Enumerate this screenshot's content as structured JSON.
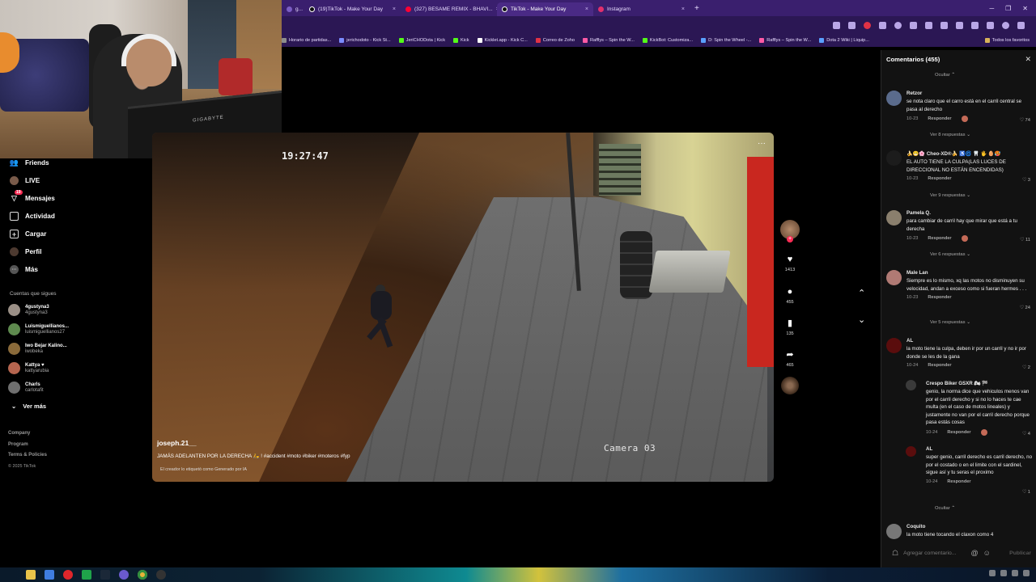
{
  "browser": {
    "tabs": [
      {
        "label": "g...",
        "icon_color": "#7b5dc4",
        "active": false
      },
      {
        "label": "(19)TikTok - Make Your Day",
        "icon_color": "#111111",
        "active": false
      },
      {
        "label": "(327) BESAME REMIX - BHAVI...",
        "icon_color": "#ff0033",
        "active": false
      },
      {
        "label": "TikTok - Make Your Day",
        "icon_color": "#111111",
        "active": true
      },
      {
        "label": "Instagram",
        "icon_color": "#e1306c",
        "active": false
      }
    ],
    "new_tab": "+",
    "bookmarks": [
      {
        "label": "Horario de partidas...",
        "color": "#8e8e8e"
      },
      {
        "label": "jerichodoto - Kick St...",
        "color": "#7b8cff"
      },
      {
        "label": "JeriCHODota | Kick",
        "color": "#53fc18"
      },
      {
        "label": "Kick",
        "color": "#53fc18"
      },
      {
        "label": "Kicklet.app - Kick C...",
        "color": "#ffffff"
      },
      {
        "label": "Correo de Zoho",
        "color": "#e03245"
      },
      {
        "label": "Rafflys – Spin the W...",
        "color": "#ff5aa5"
      },
      {
        "label": "KickBot: Customiza...",
        "color": "#53fc18"
      },
      {
        "label": "D: Spin the Wheel -...",
        "color": "#5aa0ff"
      },
      {
        "label": "Rafflys – Spin the W...",
        "color": "#ff5aa5"
      },
      {
        "label": "Dota 2 Wiki | Liquip...",
        "color": "#5aa0ff"
      }
    ],
    "all_bookmarks": "Todos los favoritos"
  },
  "webcam": {
    "monitor_brand": "GIGABYTE"
  },
  "nav": {
    "items": [
      {
        "label": "Friends",
        "icon": "friends-icon"
      },
      {
        "label": "LIVE",
        "icon": "live-icon"
      },
      {
        "label": "Mensajes",
        "icon": "messages-icon",
        "badge": "19"
      },
      {
        "label": "Actividad",
        "icon": "activity-icon"
      },
      {
        "label": "Cargar",
        "icon": "upload-icon"
      },
      {
        "label": "Perfil",
        "icon": "profile-icon"
      },
      {
        "label": "Más",
        "icon": "more-icon"
      }
    ],
    "following_heading": "Cuentas que sigues",
    "following": [
      {
        "name": "4gustyna3",
        "user": "4gustyna3",
        "color": "#9a8f86"
      },
      {
        "name": "Luismiguellianos...",
        "user": "luismiguellianos27",
        "color": "#5e8a4e"
      },
      {
        "name": "Iwo Bejar Kalino...",
        "user": "iwobeka",
        "color": "#8a6a3a"
      },
      {
        "name": "Kattya ♥",
        "user": "kattyarubia",
        "color": "#b5654f"
      },
      {
        "name": "Charls",
        "user": "carlotafit",
        "color": "#6f6f6f"
      }
    ],
    "see_more": "Ver más",
    "footer": [
      "Company",
      "Program",
      "Terms & Policies"
    ],
    "copyright": "© 2025 TikTok"
  },
  "video": {
    "cam_timestamp": "19:27:47",
    "cam_label": "Camera 03",
    "author": "joseph.21__",
    "caption": "JAMÁS ADELANTEN POR LA DERECHA 🛵 ! #accident #moto #biker #moteros #fyp",
    "ai_label": "El creador lo etiquetó como Generado por IA",
    "more": "···",
    "likes": "1413",
    "comments": "455",
    "saves": "135",
    "shares": "465"
  },
  "comments_panel": {
    "title": "Comentarios (455)",
    "hide_label": "Ocultar",
    "input_placeholder": "Agregar comentario...",
    "publish": "Publicar",
    "comments": [
      {
        "user": "Retzor",
        "text": "se nota claro que el carro está en el carril central se pasa al derecho",
        "date": "10-23",
        "reply": "Responder",
        "likes": "74",
        "more": "Ver 8 respuestas",
        "color": "#5a6b8c",
        "creator": true
      },
      {
        "user": "🍌😁🌸 Cheo-XD®🍌 ♿🌀 🦷 🖐 🥚🥵",
        "text": "EL AUTO TIENE LA CULPA(LAS LUCES DE DIRECCIONAL NO ESTÁN ENCENDIDAS)",
        "date": "10-23",
        "reply": "Responder",
        "likes": "3",
        "more": "Ver 9 respuestas",
        "color": "#1c1c1c",
        "creator": false
      },
      {
        "user": "Pamela Q.",
        "text": "para cambiar de carril hay que mirar que está a tu derecha",
        "date": "10-23",
        "reply": "Responder",
        "likes": "11",
        "more": "Ver 6 respuestas",
        "color": "#8a7f6d",
        "creator": true
      },
      {
        "user": "Male Lan",
        "text": "Siempre es lo mismo, xq las motos no disminuyen su velocidad, andan a exceso como si fueran hermes . . .",
        "date": "10-23",
        "reply": "Responder",
        "likes": "24",
        "more": "Ver 5 respuestas",
        "color": "#b07a74",
        "creator": false
      },
      {
        "user": "AL",
        "text": "la moto tiene la culpa, deben ir por un carril y no ir por donde se les de la gana",
        "date": "10-24",
        "reply": "Responder",
        "likes": "2",
        "more": "",
        "color": "#5a0d0d",
        "creator": false
      },
      {
        "user": "Crespo Biker GSXR 🏍 🏁",
        "text": "genio, la norma dice que vehiculos menos van por el carril derecho y si no lo haces te cae multa (en el caso de motos lineales) y justamente no van por el carril derecho porque pasa estás cosas",
        "date": "10-24",
        "reply": "Responder",
        "likes": "4",
        "more": "",
        "color": "#3a3a3a",
        "creator": true
      },
      {
        "user": "AL",
        "text": "super genio, carril derecho es carril derecho, no por el costado o en el limite con el sardinel, sigue así y tu seras el proximo",
        "date": "10-24",
        "reply": "Responder",
        "likes": "1",
        "more": "",
        "color": "#5a0d0d",
        "creator": false
      },
      {
        "user": "Coquito",
        "text": "la moto tiene tocando el claxon como 4",
        "color": "#777777"
      }
    ]
  }
}
